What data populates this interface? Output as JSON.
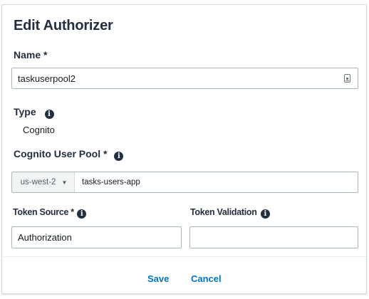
{
  "dialog": {
    "title": "Edit Authorizer",
    "name": {
      "label": "Name *",
      "value": "taskuserpool2"
    },
    "type": {
      "label": "Type",
      "value": "Cognito"
    },
    "user_pool": {
      "label": "Cognito User Pool *",
      "region": "us-west-2",
      "value": "tasks-users-app"
    },
    "token_source": {
      "label": "Token Source *",
      "value": "Authorization"
    },
    "token_validation": {
      "label": "Token Validation",
      "value": ""
    },
    "actions": {
      "save": "Save",
      "cancel": "Cancel"
    }
  },
  "icons": {
    "info": "info-icon",
    "input_helper": "keyboard-icon",
    "dropdown": "chevron-down-icon"
  },
  "colors": {
    "link": "#0073bb",
    "heading": "#232f3e",
    "border": "#aab7b8"
  }
}
